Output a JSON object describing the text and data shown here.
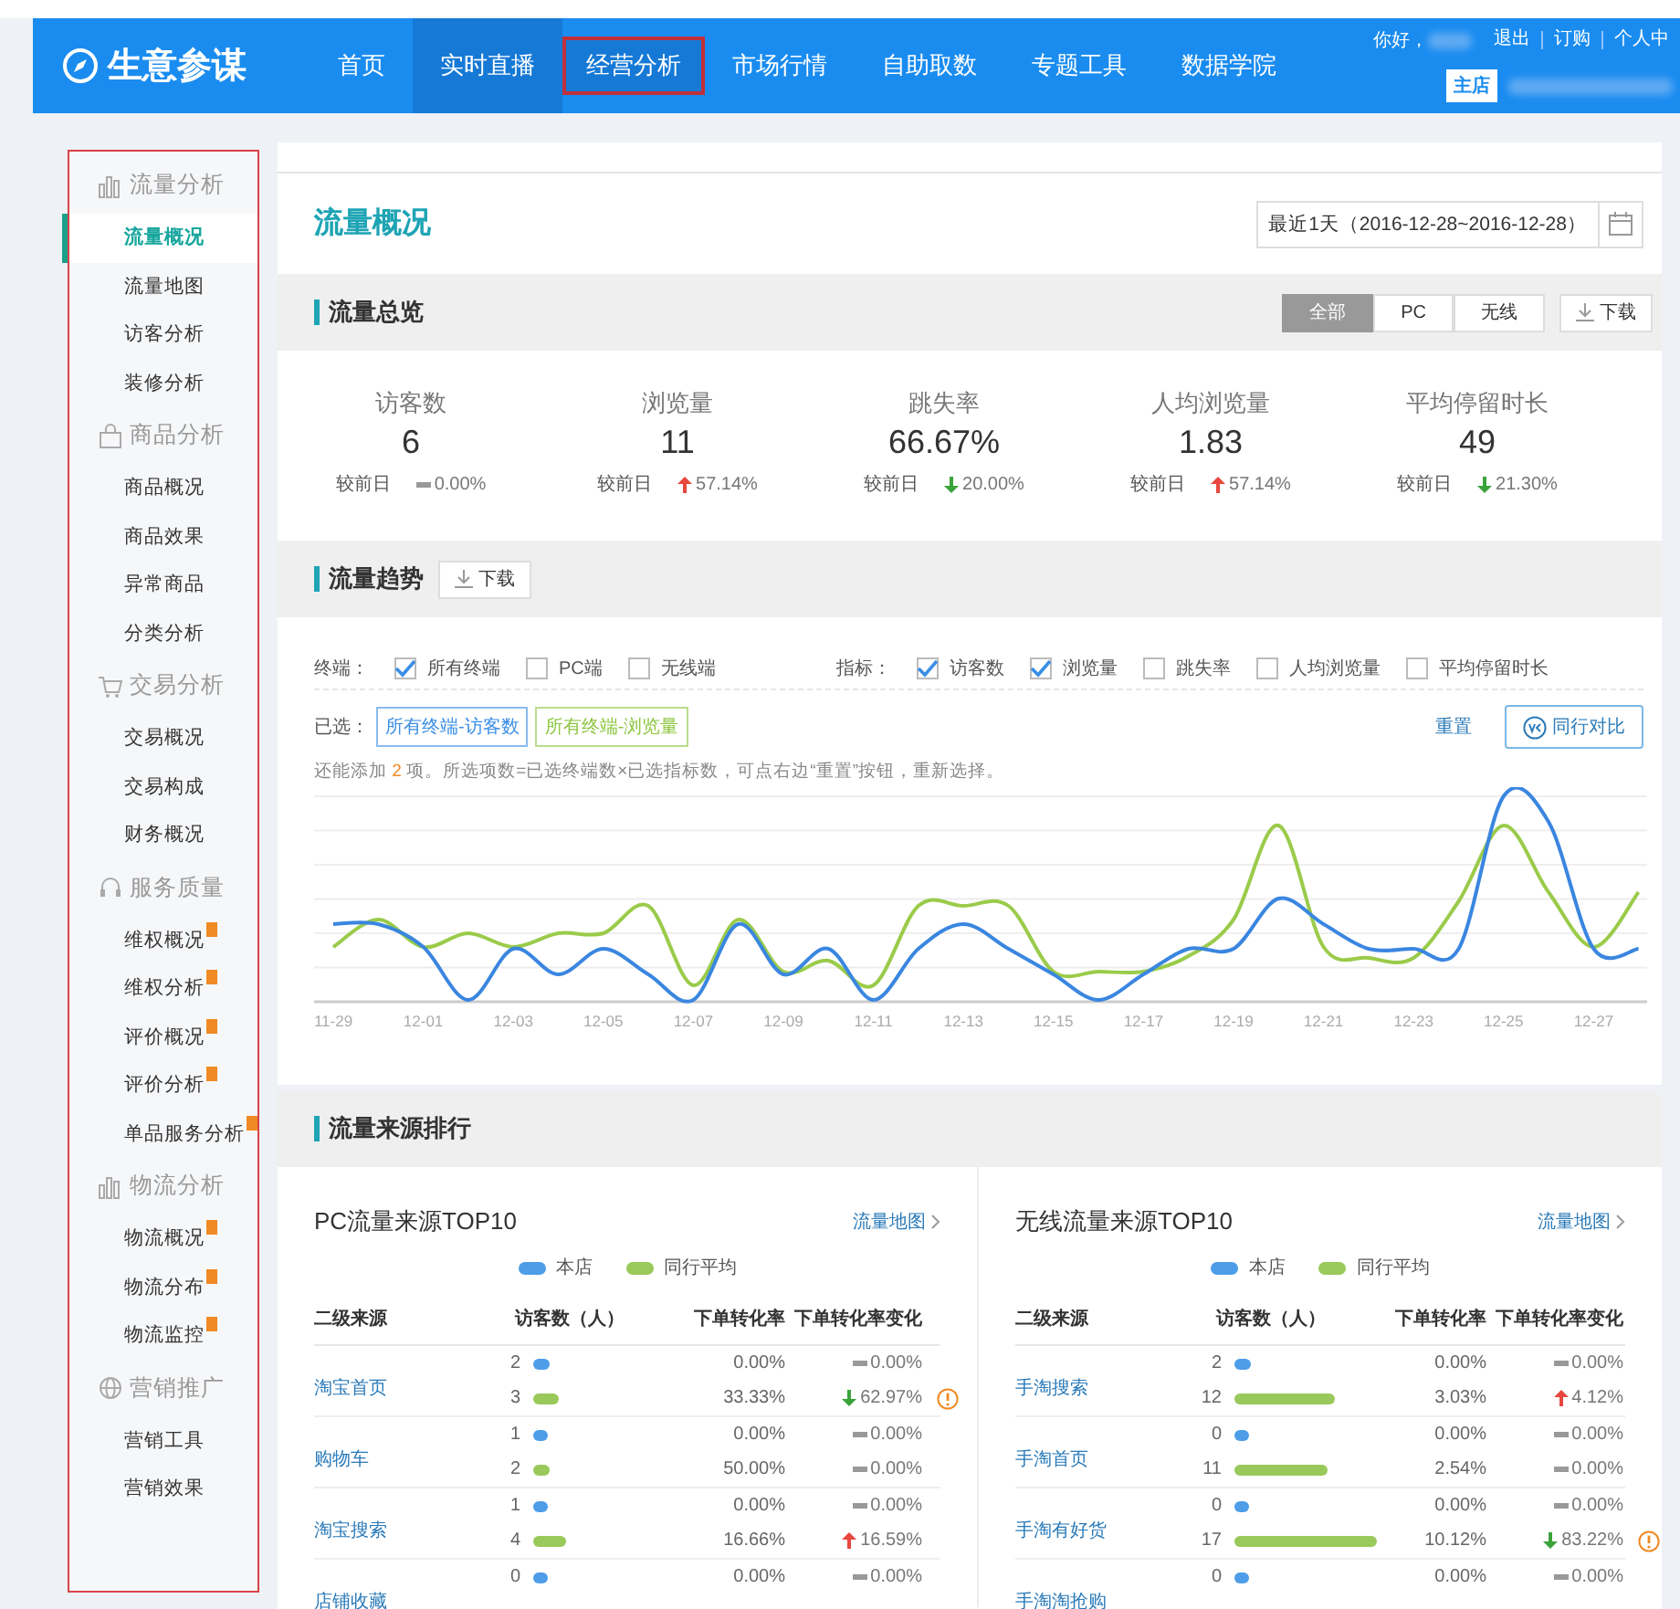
{
  "header": {
    "logo": "生意参谋",
    "nav": [
      {
        "label": "首页",
        "active": false,
        "outlined": false
      },
      {
        "label": "实时直播",
        "active": true,
        "outlined": false
      },
      {
        "label": "经营分析",
        "active": true,
        "outlined": true
      },
      {
        "label": "市场行情",
        "active": false,
        "outlined": false
      },
      {
        "label": "自助取数",
        "active": false,
        "outlined": false
      },
      {
        "label": "专题工具",
        "active": false,
        "outlined": false
      },
      {
        "label": "数据学院",
        "active": false,
        "outlined": false
      }
    ],
    "greeting": "你好，",
    "links": [
      "退出",
      "订购",
      "个人中"
    ],
    "shop_badge": "主店"
  },
  "sidebar": {
    "outlined": true,
    "groups": [
      {
        "kind": "bars",
        "label": "流量分析",
        "items": [
          {
            "label": "流量概况",
            "selected": true,
            "flag": false
          },
          {
            "label": "流量地图",
            "selected": false,
            "flag": false
          },
          {
            "label": "访客分析",
            "selected": false,
            "flag": false
          },
          {
            "label": "装修分析",
            "selected": false,
            "flag": false
          }
        ]
      },
      {
        "kind": "bag",
        "label": "商品分析",
        "items": [
          {
            "label": "商品概况",
            "selected": false,
            "flag": false
          },
          {
            "label": "商品效果",
            "selected": false,
            "flag": false
          },
          {
            "label": "异常商品",
            "selected": false,
            "flag": false
          },
          {
            "label": "分类分析",
            "selected": false,
            "flag": false
          }
        ]
      },
      {
        "kind": "cart",
        "label": "交易分析",
        "items": [
          {
            "label": "交易概况",
            "selected": false,
            "flag": false
          },
          {
            "label": "交易构成",
            "selected": false,
            "flag": false
          },
          {
            "label": "财务概况",
            "selected": false,
            "flag": false
          }
        ]
      },
      {
        "kind": "headset",
        "label": "服务质量",
        "items": [
          {
            "label": "维权概况",
            "selected": false,
            "flag": true
          },
          {
            "label": "维权分析",
            "selected": false,
            "flag": true
          },
          {
            "label": "评价概况",
            "selected": false,
            "flag": true
          },
          {
            "label": "评价分析",
            "selected": false,
            "flag": true
          },
          {
            "label": "单品服务分析",
            "selected": false,
            "flag": true
          }
        ]
      },
      {
        "kind": "bars",
        "label": "物流分析",
        "items": [
          {
            "label": "物流概况",
            "selected": false,
            "flag": true
          },
          {
            "label": "物流分布",
            "selected": false,
            "flag": true
          },
          {
            "label": "物流监控",
            "selected": false,
            "flag": true
          }
        ]
      },
      {
        "kind": "globe",
        "label": "营销推广",
        "items": [
          {
            "label": "营销工具",
            "selected": false,
            "flag": false
          },
          {
            "label": "营销效果",
            "selected": false,
            "flag": false
          }
        ]
      }
    ]
  },
  "page_title": "流量概况",
  "date_range": "最近1天（2016-12-28~2016-12-28）",
  "overview": {
    "title": "流量总览",
    "download": "下载",
    "segments": [
      {
        "label": "全部",
        "selected": true
      },
      {
        "label": "PC",
        "selected": false
      },
      {
        "label": "无线",
        "selected": false
      }
    ],
    "stats": [
      {
        "label": "访客数",
        "value": "6",
        "compare": "较前日",
        "kind": "flat",
        "change": "0.00%"
      },
      {
        "label": "浏览量",
        "value": "11",
        "compare": "较前日",
        "kind": "up",
        "change": "57.14%"
      },
      {
        "label": "跳失率",
        "value": "66.67%",
        "compare": "较前日",
        "kind": "down",
        "change": "20.00%"
      },
      {
        "label": "人均浏览量",
        "value": "1.83",
        "compare": "较前日",
        "kind": "up",
        "change": "57.14%"
      },
      {
        "label": "平均停留时长",
        "value": "49",
        "compare": "较前日",
        "kind": "down",
        "change": "21.30%"
      }
    ]
  },
  "trend": {
    "title": "流量趋势",
    "download": "下载",
    "terminal_label": "终端：",
    "terminals": [
      {
        "label": "所有终端",
        "checked": true
      },
      {
        "label": "PC端",
        "checked": false
      },
      {
        "label": "无线端",
        "checked": false
      }
    ],
    "metric_label": "指标：",
    "metrics": [
      {
        "label": "访客数",
        "checked": true
      },
      {
        "label": "浏览量",
        "checked": true
      },
      {
        "label": "跳失率",
        "checked": false
      },
      {
        "label": "人均浏览量",
        "checked": false
      },
      {
        "label": "平均停留时长",
        "checked": false
      }
    ],
    "selected_label": "已选：",
    "tags": [
      {
        "label": "所有终端-访客数",
        "color": "#3a8ee6"
      },
      {
        "label": "所有终端-浏览量",
        "color": "#8cc63f"
      }
    ],
    "reset": "重置",
    "compare_button": "同行对比",
    "hint": {
      "before": "还能添加 ",
      "count": "2",
      "after": " 项。所选项数=已选终端数×已选指标数，可点右边“重置”按钮，重新选择。"
    },
    "x_labels": [
      "11-29",
      "12-01",
      "12-03",
      "12-05",
      "12-07",
      "12-09",
      "12-11",
      "12-13",
      "12-15",
      "12-17",
      "12-19",
      "12-21",
      "12-23",
      "12-25",
      "12-27"
    ]
  },
  "ranking": {
    "title": "流量来源排行",
    "panels": [
      {
        "title": "PC流量来源TOP10",
        "link": "流量地图",
        "legend": [
          {
            "label": "本店",
            "color": "#4d9de8"
          },
          {
            "label": "同行平均",
            "color": "#99c95a"
          }
        ],
        "columns": [
          "二级来源",
          "访客数（人）",
          "下单转化率",
          "下单转化率变化"
        ],
        "rows": [
          {
            "source": "淘宝首页",
            "entries": [
              {
                "count": "2",
                "rate": "0.00%",
                "kind": "flat",
                "change": "0.00%",
                "warning": false
              },
              {
                "count": "3",
                "rate": "33.33%",
                "kind": "down",
                "change": "62.97%",
                "warning": true
              }
            ]
          },
          {
            "source": "购物车",
            "entries": [
              {
                "count": "1",
                "rate": "0.00%",
                "kind": "flat",
                "change": "0.00%",
                "warning": false
              },
              {
                "count": "2",
                "rate": "50.00%",
                "kind": "flat",
                "change": "0.00%",
                "warning": false
              }
            ]
          },
          {
            "source": "淘宝搜索",
            "entries": [
              {
                "count": "1",
                "rate": "0.00%",
                "kind": "flat",
                "change": "0.00%",
                "warning": false
              },
              {
                "count": "4",
                "rate": "16.66%",
                "kind": "up",
                "change": "16.59%",
                "warning": false
              }
            ]
          },
          {
            "source": "店铺收藏",
            "entries": [
              {
                "count": "0",
                "rate": "0.00%",
                "kind": "flat",
                "change": "0.00%",
                "warning": false
              }
            ]
          }
        ]
      },
      {
        "title": "无线流量来源TOP10",
        "link": "流量地图",
        "legend": [
          {
            "label": "本店",
            "color": "#4d9de8"
          },
          {
            "label": "同行平均",
            "color": "#99c95a"
          }
        ],
        "columns": [
          "二级来源",
          "访客数（人）",
          "下单转化率",
          "下单转化率变化"
        ],
        "rows": [
          {
            "source": "手淘搜索",
            "entries": [
              {
                "count": "2",
                "rate": "0.00%",
                "kind": "flat",
                "change": "0.00%",
                "warning": false
              },
              {
                "count": "12",
                "rate": "3.03%",
                "kind": "up",
                "change": "4.12%",
                "warning": false
              }
            ]
          },
          {
            "source": "手淘首页",
            "entries": [
              {
                "count": "0",
                "rate": "0.00%",
                "kind": "flat",
                "change": "0.00%",
                "warning": false
              },
              {
                "count": "11",
                "rate": "2.54%",
                "kind": "flat",
                "change": "0.00%",
                "warning": false
              }
            ]
          },
          {
            "source": "手淘有好货",
            "entries": [
              {
                "count": "0",
                "rate": "0.00%",
                "kind": "flat",
                "change": "0.00%",
                "warning": false
              },
              {
                "count": "17",
                "rate": "10.12%",
                "kind": "down",
                "change": "83.22%",
                "warning": true
              }
            ]
          },
          {
            "source": "手淘淘抢购",
            "entries": [
              {
                "count": "0",
                "rate": "0.00%",
                "kind": "flat",
                "change": "0.00%",
                "warning": false
              }
            ]
          }
        ]
      }
    ]
  }
}
